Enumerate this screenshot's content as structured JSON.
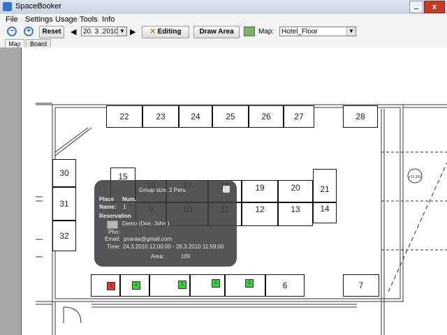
{
  "window": {
    "title": "SpaceBooker",
    "minimize": "_",
    "close": "x"
  },
  "menu": [
    "File",
    "Settings",
    "Usage",
    "Tools",
    "Info"
  ],
  "toolbar": {
    "zoom_out_glyph": "−",
    "zoom_in_glyph": "+",
    "reset_label": "Reset",
    "date_value": "20. 3 .2010",
    "editing_label": "Editing",
    "draw_area_label": "Draw Area",
    "map_label": "Map:",
    "map_value": "Hotel_Floor",
    "prev_glyph": "◀",
    "next_glyph": "▶",
    "dropdown_glyph": "▼"
  },
  "tabs": [
    "Map",
    "Board"
  ],
  "floor": {
    "top_row": [
      "22",
      "23",
      "24",
      "25",
      "26",
      "27"
    ],
    "right_top": "28",
    "left_column": [
      "30",
      "31",
      "32"
    ],
    "center_upper": [
      "15",
      "16",
      "17",
      "18",
      "19",
      "20",
      "21"
    ],
    "center_lower": [
      "9",
      "10",
      "11",
      "12",
      "13",
      "14"
    ],
    "bottom_labels": [
      "6",
      "7"
    ],
    "elevation": "+10.350",
    "status_marks": [
      {
        "label": "1",
        "color": "#e23a3a"
      },
      {
        "label": "1",
        "color": "#3ccf3c"
      },
      {
        "label": "1",
        "color": "#3ccf3c"
      },
      {
        "label": "1",
        "color": "#3ccf3c"
      },
      {
        "label": "1",
        "color": "#3ccf3c"
      }
    ]
  },
  "popup": {
    "group_size": "Group size: 2 Pers.",
    "place_label": "Place",
    "num_label": "Num.",
    "name_label": "Name:",
    "name_value": "1",
    "reservation_label": "Reservation",
    "person": "Demo (Doe, John )",
    "phone_label": "Pho:",
    "email_label": "Email:",
    "email_value": "pvaraa@gmail.com",
    "time_label": "Time:",
    "time_value": "24.3.2010 12:00:00 - 26.3.2010 11:59:00",
    "area_label": "Area:",
    "area_value": "109"
  },
  "colors": {
    "sidebar": "#a9a9a9",
    "popup_bg": "#3c3e42"
  }
}
